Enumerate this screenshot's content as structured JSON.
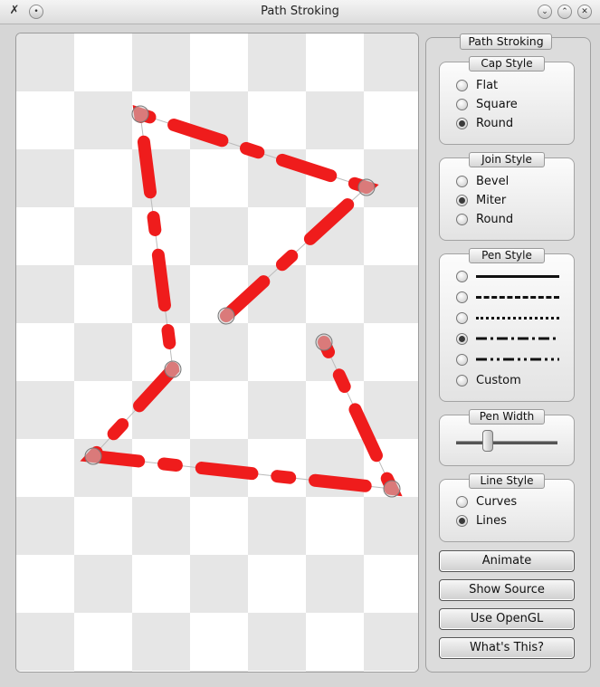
{
  "window": {
    "title": "Path Stroking"
  },
  "panel": {
    "title": "Path Stroking",
    "cap_style": {
      "title": "Cap Style",
      "options": [
        "Flat",
        "Square",
        "Round"
      ],
      "selected": "Round"
    },
    "join_style": {
      "title": "Join Style",
      "options": [
        "Bevel",
        "Miter",
        "Round"
      ],
      "selected": "Miter"
    },
    "pen_style": {
      "title": "Pen Style",
      "custom_label": "Custom",
      "selected_index": 3
    },
    "pen_width": {
      "title": "Pen Width",
      "value_fraction": 0.3
    },
    "line_style": {
      "title": "Line Style",
      "options": [
        "Curves",
        "Lines"
      ],
      "selected": "Lines"
    },
    "buttons": {
      "animate": "Animate",
      "show_source": "Show Source",
      "use_opengl": "Use OpenGL",
      "whats_this": "What's This?"
    }
  },
  "colors": {
    "stroke": "#ef1c1c",
    "checker_dark": "#e6e6e6",
    "checker_light": "#ffffff"
  }
}
